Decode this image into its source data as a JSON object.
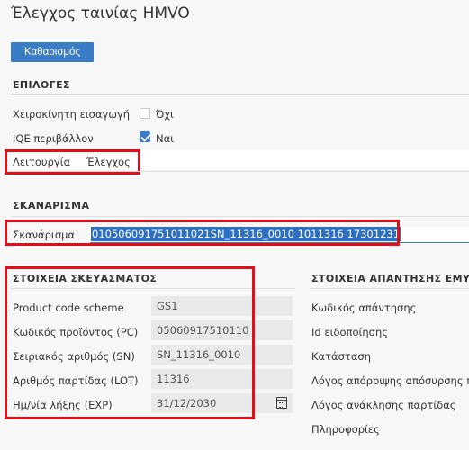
{
  "page": {
    "title": "Έλεγχος ταινίας HMVO"
  },
  "toolbar": {
    "clear_label": "Καθαρισμός"
  },
  "options": {
    "heading": "ΕΠΙΛΟΓΕΣ",
    "manual_entry": {
      "label": "Χειροκίνητη εισαγωγή",
      "value": "Όχι",
      "checked": false
    },
    "iqe_env": {
      "label": "IQE περιβάλλον",
      "value": "Ναι",
      "checked": true
    },
    "operation": {
      "label": "Λειτουργία",
      "value": "Έλεγχος"
    }
  },
  "scan": {
    "heading": "ΣΚΑΝΑΡΙΣΜΑ",
    "label": "Σκανάρισμα",
    "value": "010506091751011021SN_11316_0010 1011316 17301231"
  },
  "package": {
    "heading": "ΣΤΟΙΧΕΙΑ ΣΚΕΥΑΣΜΑΤΟΣ",
    "fields": [
      {
        "label": "Product code scheme",
        "value": "GS1"
      },
      {
        "label": "Κωδικός προϊόντος (PC)",
        "value": "05060917510110"
      },
      {
        "label": "Σειριακός αριθμός (SN)",
        "value": "SN_11316_0010"
      },
      {
        "label": "Αριθμός παρτίδας (LOT)",
        "value": "11316"
      },
      {
        "label": "Ημ/νία λήξης (EXP)",
        "value": "31/12/2030",
        "icon": "calendar-icon"
      }
    ]
  },
  "response": {
    "heading": "ΣΤΟΙΧΕΙΑ ΑΠΑΝΤΗΣΗΣ ΕΜΥ",
    "labels": [
      "Κωδικός απάντησης",
      "Id ειδοποίησης",
      "Κατάσταση",
      "Λόγος απόρριψης απόσυρσης π",
      "Λόγος ανάκλησης παρτίδας",
      "Πληροφορίες"
    ]
  },
  "colors": {
    "accent": "#3b7dc4",
    "highlight": "#e0101a"
  }
}
